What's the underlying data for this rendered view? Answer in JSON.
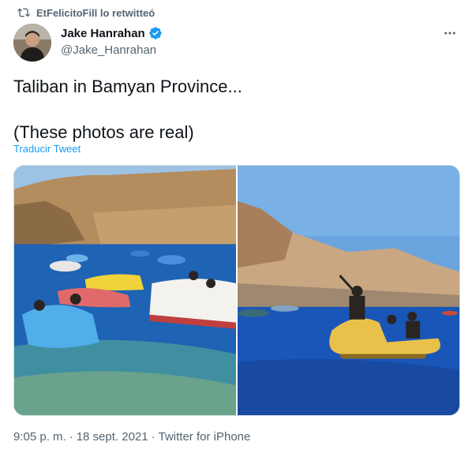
{
  "retweet": {
    "text": "EtFelicitoFill lo retwitteó",
    "icon": "retweet-icon"
  },
  "author": {
    "name": "Jake Hanrahan",
    "handle": "@Jake_Hanrahan",
    "verified": true,
    "avatar": "avatar-photo"
  },
  "tweet": {
    "line1": "Taliban in Bamyan Province...",
    "line2": "(These photos are real)",
    "translate": "Traducir Tweet"
  },
  "media": [
    {
      "description_icon": "lake-photo-left"
    },
    {
      "description_icon": "lake-photo-right"
    }
  ],
  "meta": {
    "time": "9:05 p. m.",
    "sep1": "·",
    "date": "18 sept. 2021",
    "sep2": "·",
    "source": "Twitter for iPhone"
  },
  "colors": {
    "accent": "#1d9bf0",
    "muted": "#536471",
    "text": "#0f1419"
  }
}
